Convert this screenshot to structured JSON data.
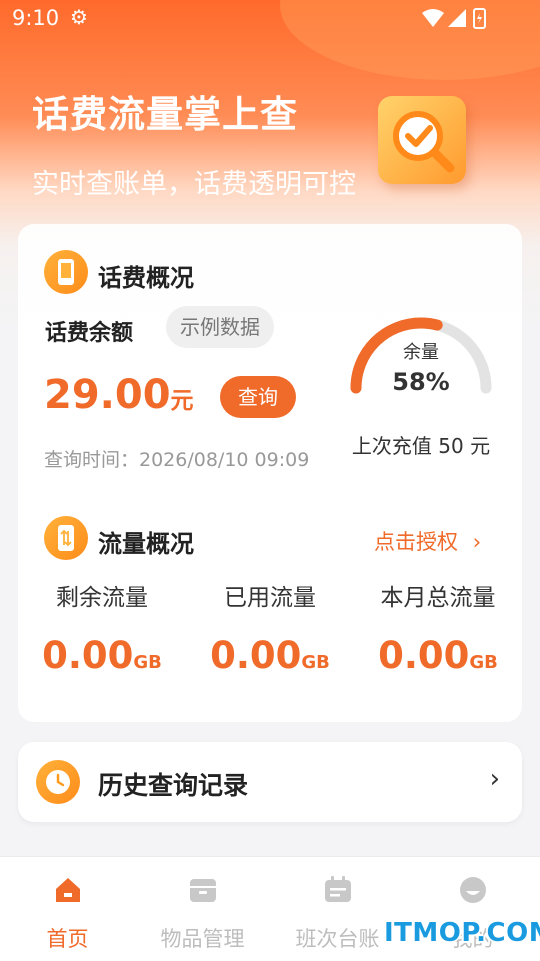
{
  "status_bar": {
    "time": "9:10"
  },
  "hero": {
    "title": "话费流量掌上查",
    "subtitle": "实时查账单，话费透明可控"
  },
  "bill": {
    "section_title": "话费概况",
    "balance_label": "话费余额",
    "sample_tag": "示例数据",
    "balance_value": "29.00",
    "balance_unit": "元",
    "query_button": "查询",
    "query_time": "查询时间：2026/08/10 09:09",
    "gauge_label": "余量",
    "gauge_percent": "58%",
    "gauge_fraction": 0.58,
    "last_recharge": "上次充值 50 元"
  },
  "flow": {
    "section_title": "流量概况",
    "auth_link": "点击授权",
    "columns": [
      {
        "label": "剩余流量",
        "value": "0.00",
        "unit": "GB"
      },
      {
        "label": "已用流量",
        "value": "0.00",
        "unit": "GB"
      },
      {
        "label": "本月总流量",
        "value": "0.00",
        "unit": "GB"
      }
    ]
  },
  "history": {
    "label": "历史查询记录"
  },
  "tabs": [
    {
      "label": "首页",
      "icon": "home-icon",
      "active": true
    },
    {
      "label": "物品管理",
      "icon": "box-icon",
      "active": false
    },
    {
      "label": "班次台账",
      "icon": "calendar-icon",
      "active": false
    },
    {
      "label": "我的",
      "icon": "profile-icon",
      "active": false
    }
  ],
  "watermark": "ITMOP.COM",
  "colors": {
    "accent": "#f06a2a",
    "icon_gradient_start": "#ffb13a",
    "tab_inactive": "#bdbdbd"
  }
}
